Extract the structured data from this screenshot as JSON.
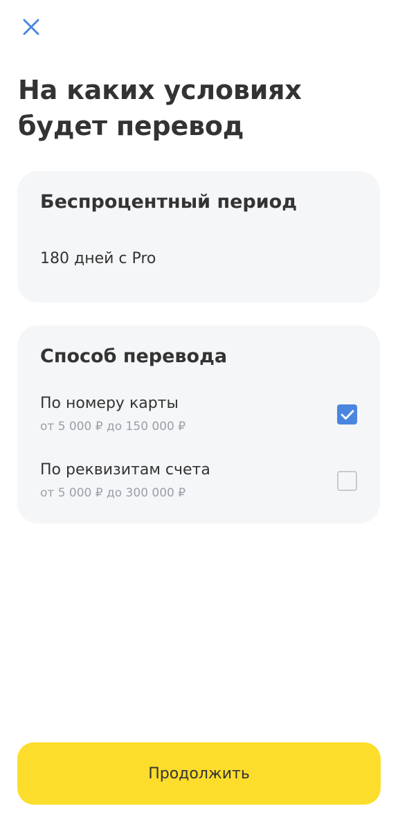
{
  "header": {
    "close_icon": "close-icon",
    "title": "На каких условиях будет перевод"
  },
  "period_card": {
    "title": "Беспроцентный период",
    "value": "180 дней с Pro"
  },
  "method_card": {
    "title": "Способ перевода",
    "options": [
      {
        "label": "По номеру карты",
        "range": "от 5 000 ₽ до 150 000 ₽",
        "checked": true
      },
      {
        "label": "По реквизитам счета",
        "range": "от 5 000 ₽ до 300 000 ₽",
        "checked": false
      }
    ]
  },
  "footer": {
    "continue_label": "Продолжить"
  },
  "colors": {
    "accent": "#4a86e0",
    "button": "#fddd2c",
    "card_bg": "#f5f6f8",
    "text": "#333333",
    "muted": "#9a9ea6"
  }
}
